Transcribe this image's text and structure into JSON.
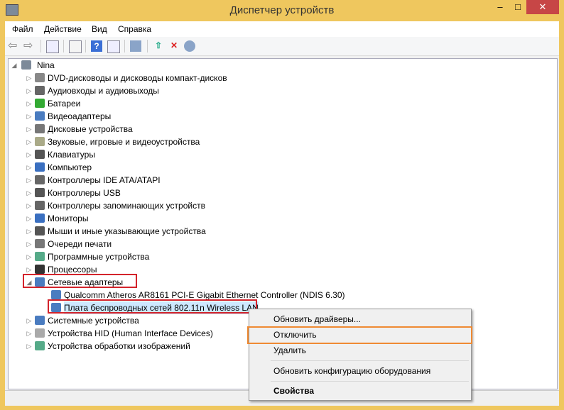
{
  "window": {
    "title": "Диспетчер устройств",
    "minimize": "–",
    "maximize": "□",
    "close": "✕"
  },
  "menubar": [
    "Файл",
    "Действие",
    "Вид",
    "Справка"
  ],
  "toolbar": [
    "back-icon",
    "forward-icon",
    "console-tree-icon",
    "properties-icon",
    "help-icon",
    "action-pane-icon",
    "scan-hardware-icon",
    "update-driver-icon",
    "disable-icon",
    "uninstall-icon"
  ],
  "tree": {
    "root": "Nina",
    "categories": [
      "DVD-дисководы и дисководы компакт-дисков",
      "Аудиовходы и аудиовыходы",
      "Батареи",
      "Видеоадаптеры",
      "Дисковые устройства",
      "Звуковые, игровые и видеоустройства",
      "Клавиатуры",
      "Компьютер",
      "Контроллеры IDE ATA/ATAPI",
      "Контроллеры USB",
      "Контроллеры запоминающих устройств",
      "Мониторы",
      "Мыши и иные указывающие устройства",
      "Очереди печати",
      "Программные устройства",
      "Процессоры",
      "Сетевые адаптеры"
    ],
    "network_children": [
      "Qualcomm Atheros AR8161 PCI-E Gigabit Ethernet Controller (NDIS 6.30)",
      "Плата беспроводных сетей 802.11n Wireless LAN"
    ],
    "after": [
      "Системные устройства",
      "Устройства HID (Human Interface Devices)",
      "Устройства обработки изображений"
    ]
  },
  "context_menu": {
    "update": "Обновить драйверы...",
    "disable": "Отключить",
    "uninstall": "Удалить",
    "scan": "Обновить конфигурацию оборудования",
    "properties": "Свойства"
  }
}
